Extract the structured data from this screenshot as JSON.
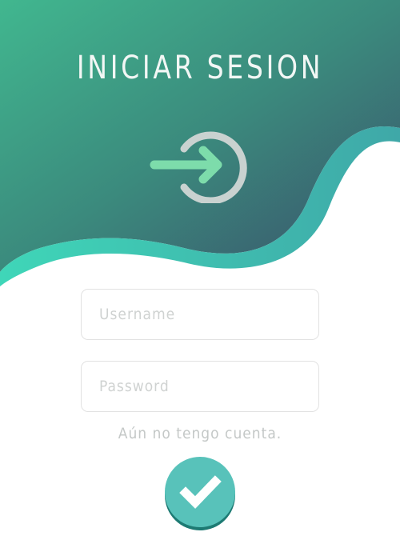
{
  "header": {
    "title": "INICIAR SESION",
    "icon": "login-arrow-icon"
  },
  "form": {
    "username": {
      "placeholder": "Username",
      "value": ""
    },
    "password": {
      "placeholder": "Password",
      "value": ""
    },
    "no_account_link": "Aún no tengo cuenta.",
    "submit_icon": "checkmark-icon"
  },
  "colors": {
    "gradient_start": "#3fb38e",
    "gradient_end": "#3a5a6e",
    "wave_edge": "#3fc9b5",
    "arrow": "#7ddcab",
    "circle": "#c9d2d0",
    "button": "#58c2ba",
    "button_shadow": "#1d7a73"
  }
}
